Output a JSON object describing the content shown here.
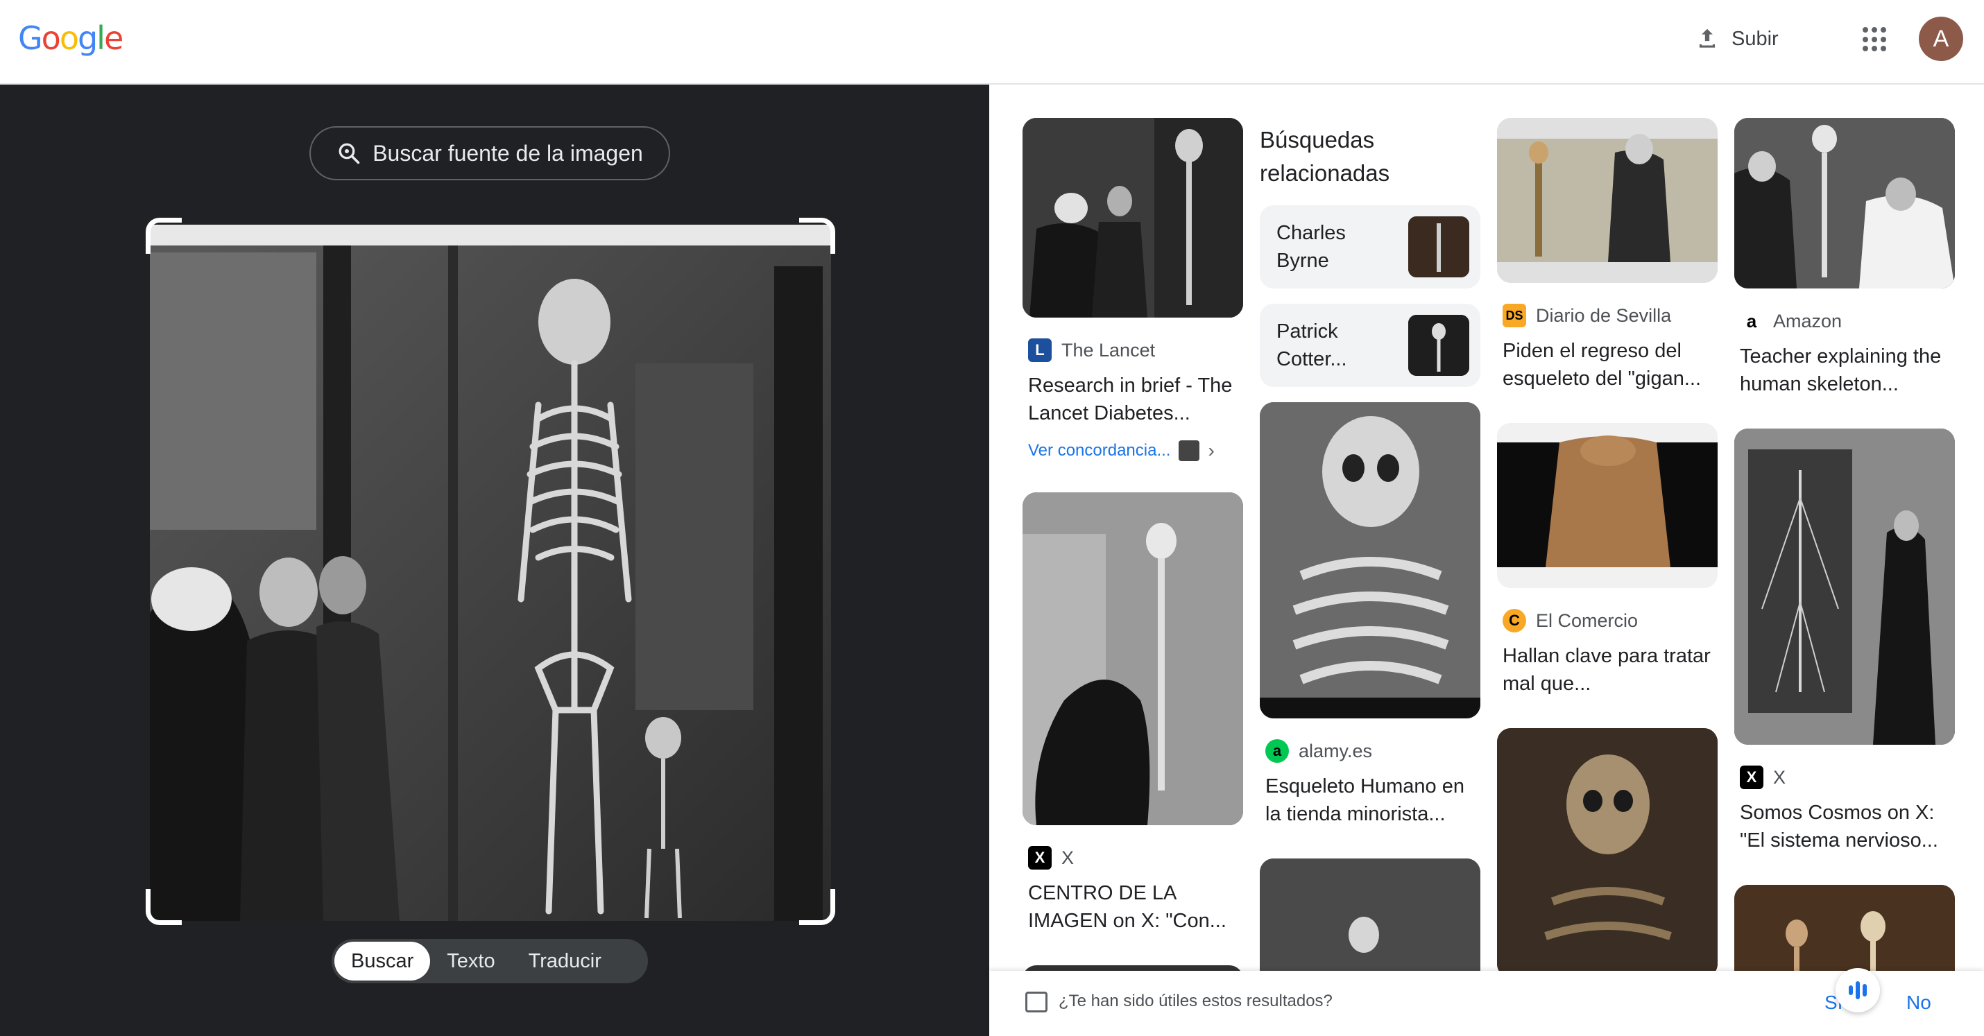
{
  "header": {
    "logo_letters": [
      "G",
      "o",
      "o",
      "g",
      "l",
      "e"
    ],
    "upload_label": "Subir",
    "avatar_initial": "A"
  },
  "left": {
    "source_button": "Buscar fuente de la imagen",
    "modes": [
      "Buscar",
      "Texto",
      "Traducir"
    ],
    "active_mode": "Buscar"
  },
  "related": {
    "heading": "Búsquedas relacionadas",
    "chips": [
      "Charles Byrne",
      "Patrick Cotter..."
    ]
  },
  "results": {
    "lancet": {
      "source": "The Lancet",
      "title": "Research in brief - The Lancet Diabetes...",
      "match": "Ver concordancia..."
    },
    "x_centro": {
      "source": "X",
      "title": "CENTRO DE LA IMAGEN on X: \"Con..."
    },
    "alamy": {
      "source": "alamy.es",
      "title": "Esqueleto Humano en la tienda minorista..."
    },
    "diario": {
      "source": "Diario de Sevilla",
      "favicon": "DS",
      "title": "Piden el regreso del esqueleto del \"gigan..."
    },
    "comercio": {
      "source": "El Comercio",
      "favicon": "C",
      "title": "Hallan clave para tratar mal que..."
    },
    "amazon": {
      "source": "Amazon",
      "favicon": "a",
      "title": "Teacher explaining the human skeleton..."
    },
    "x_cosmos": {
      "source": "X",
      "title": "Somos Cosmos on X: \"El sistema nervioso..."
    }
  },
  "feedback": {
    "question": "¿Te han sido útiles estos resultados?",
    "yes": "Sí",
    "no": "No"
  },
  "colors": {
    "dark_panel": "#202124",
    "link_blue": "#1a73e8",
    "google_blue": "#4285f4",
    "google_red": "#ea4335",
    "google_yellow": "#fbbc05",
    "google_green": "#34a853"
  }
}
